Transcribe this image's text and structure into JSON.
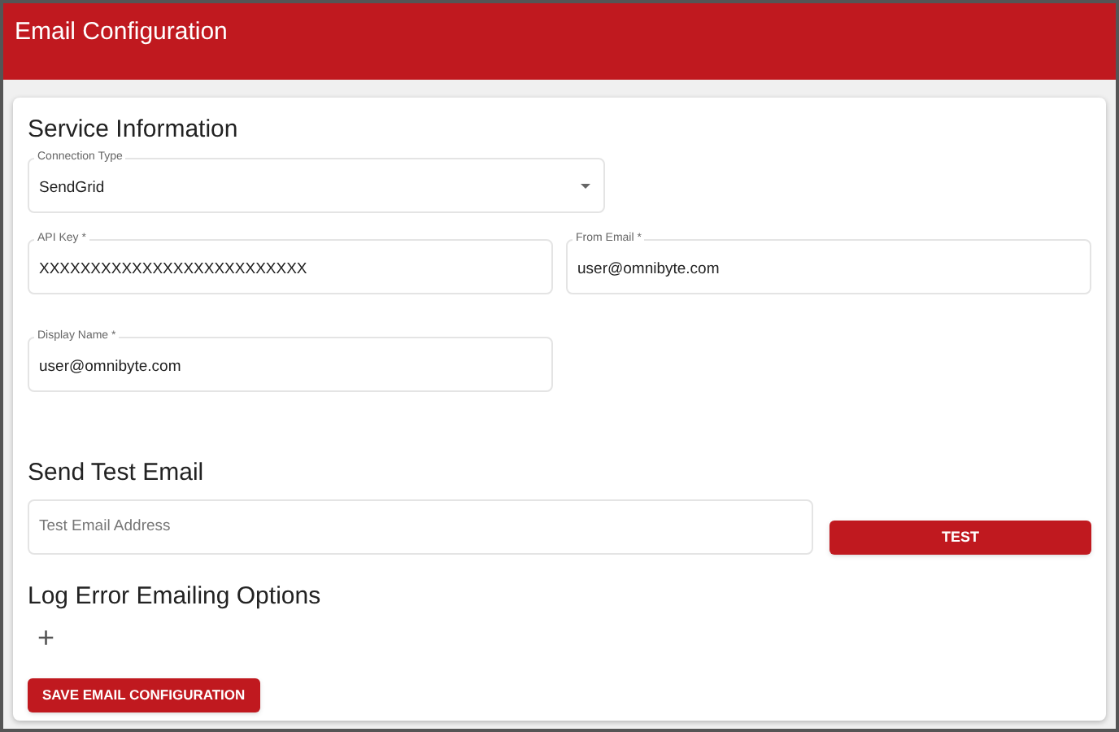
{
  "header": {
    "title": "Email Configuration"
  },
  "service_information": {
    "heading": "Service Information",
    "connection_type": {
      "label": "Connection Type",
      "value": "SendGrid"
    },
    "api_key": {
      "label": "API Key *",
      "value": "XXXXXXXXXXXXXXXXXXXXXXXXXX"
    },
    "from_email": {
      "label": "From Email *",
      "value": "user@omnibyte.com"
    },
    "display_name": {
      "label": "Display Name *",
      "value": "user@omnibyte.com"
    }
  },
  "send_test_email": {
    "heading": "Send Test Email",
    "address": {
      "placeholder": "Test Email Address"
    },
    "button": "TEST"
  },
  "log_error_options": {
    "heading": "Log Error Emailing Options",
    "add_icon": "+"
  },
  "save_button": "SAVE EMAIL CONFIGURATION"
}
